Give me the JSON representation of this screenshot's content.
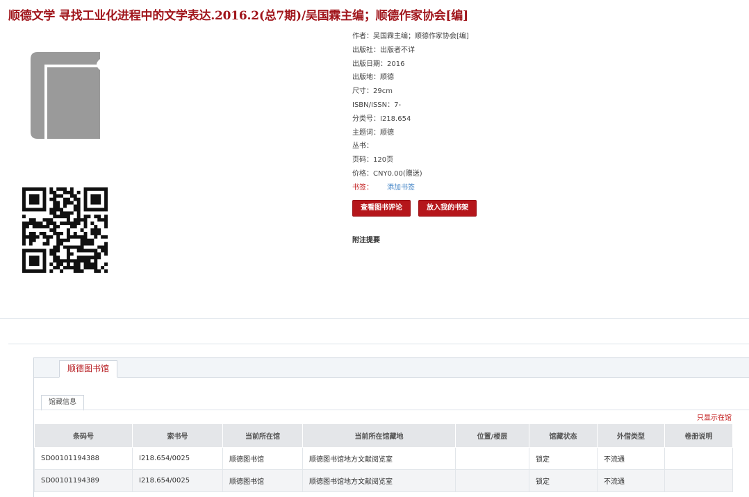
{
  "title": "顺德文学 寻找工业化进程中的文学表达.2016.2(总7期)/吴国霖主编；顺德作家协会[编]",
  "info": {
    "author_label": "作者：",
    "author": "吴国霖主编；顺德作家协会[编]",
    "publisher_label": "出版社：",
    "publisher": "出版者不详",
    "date_label": "出版日期：",
    "date": "2016",
    "place_label": "出版地：",
    "place": "顺德",
    "size_label": "尺寸：",
    "size": "29cm",
    "isbn_label": "ISBN/ISSN：",
    "isbn": "7-",
    "class_label": "分类号：",
    "class": "I218.654",
    "subject_label": "主题词：",
    "subject": "顺德",
    "series_label": "丛书：",
    "series": "",
    "pages_label": "页码：",
    "pages": "120页",
    "price_label": "价格：",
    "price": "CNY0.00(赠送)",
    "bookmark_label": "书签：",
    "bookmark_link": "添加书签"
  },
  "buttons": {
    "review": "查看图书评论",
    "shelf": "放入我的书架"
  },
  "notes_title": "附注提要",
  "holdings": {
    "library_tab": "顺德图书馆",
    "sub_tab": "馆藏信息",
    "only_in_library": "只显示在馆",
    "headers": [
      "条码号",
      "索书号",
      "当前所在馆",
      "当前所在馆藏地",
      "位置/楼层",
      "馆藏状态",
      "外借类型",
      "卷册说明"
    ],
    "rows": [
      [
        "SD00101194388",
        "I218.654/0025",
        "顺德图书馆",
        "顺德图书馆地方文献阅览室",
        "",
        "锁定",
        "不流通",
        ""
      ],
      [
        "SD00101194389",
        "I218.654/0025",
        "顺德图书馆",
        "顺德图书馆地方文献阅览室",
        "",
        "锁定",
        "不流通",
        ""
      ]
    ]
  },
  "colors": {
    "accent": "#b5161b",
    "link": "#3b7fc4",
    "header_bg": "#e4e6e9"
  },
  "icons": {
    "cover": "book-icon",
    "qr": "qr-code"
  }
}
